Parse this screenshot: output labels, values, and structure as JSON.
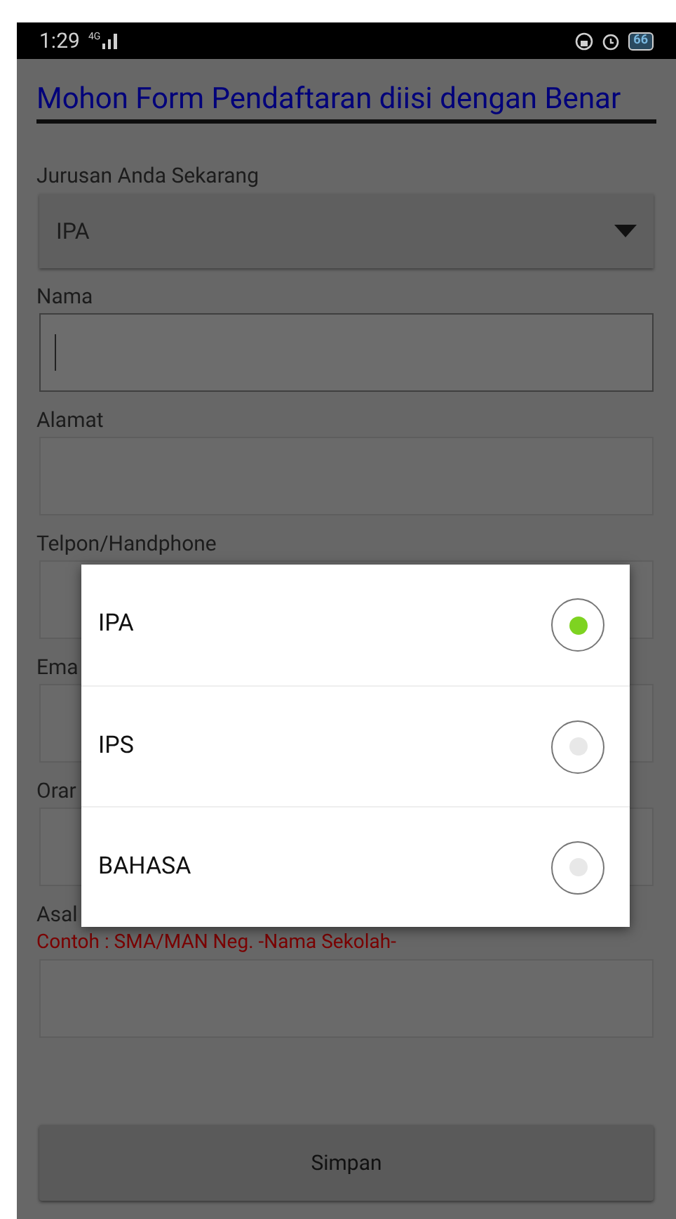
{
  "status_bar": {
    "time": "1:29",
    "network": "4G",
    "battery": "66"
  },
  "header": {
    "title": "Mohon Form Pendaftaran diisi dengan Benar"
  },
  "form": {
    "major_label": "Jurusan Anda Sekarang",
    "major_value": "IPA",
    "fields": [
      {
        "label": "Nama",
        "focused": true
      },
      {
        "label": "Alamat",
        "focused": false
      },
      {
        "label": "Telpon/Handphone",
        "focused": false
      },
      {
        "label": "Ema",
        "focused": false
      },
      {
        "label": "Orar",
        "focused": false
      },
      {
        "label": "Asal",
        "hint": "Contoh : SMA/MAN Neg. -Nama Sekolah-",
        "focused": false
      }
    ],
    "submit": "Simpan"
  },
  "dialog": {
    "options": [
      {
        "label": "IPA",
        "selected": true
      },
      {
        "label": "IPS",
        "selected": false
      },
      {
        "label": "BAHASA",
        "selected": false
      }
    ]
  }
}
